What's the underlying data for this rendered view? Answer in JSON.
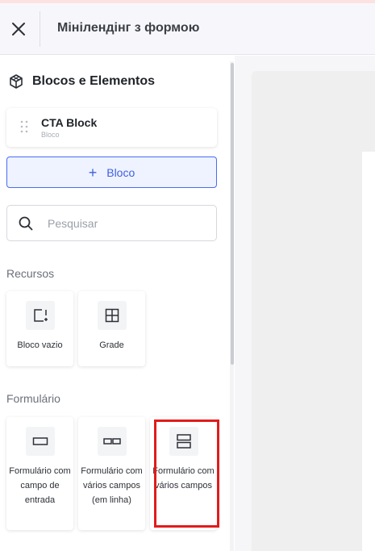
{
  "header": {
    "title": "Мінілендінг з формою"
  },
  "sidebar": {
    "section_title": "Blocos e Elementos",
    "cta_block": {
      "title": "CTA Block",
      "subtitle": "Bloco"
    },
    "add_block_label": "Bloco",
    "search": {
      "placeholder": "Pesquisar",
      "value": ""
    },
    "groups": [
      {
        "label": "Recursos",
        "items": [
          {
            "label": "Bloco vazio",
            "icon": "empty-block-icon"
          },
          {
            "label": "Grade",
            "icon": "grid-icon"
          }
        ]
      },
      {
        "label": "Formulário",
        "items": [
          {
            "label": "Formulário com campo de entrada",
            "icon": "single-input-icon"
          },
          {
            "label": "Formulário com vários campos (em linha)",
            "icon": "inline-fields-icon"
          },
          {
            "label": "Formulário com vários campos",
            "icon": "stacked-fields-icon"
          }
        ]
      }
    ]
  },
  "colors": {
    "accent": "#3f5fe0",
    "highlight": "#e21b1b"
  }
}
